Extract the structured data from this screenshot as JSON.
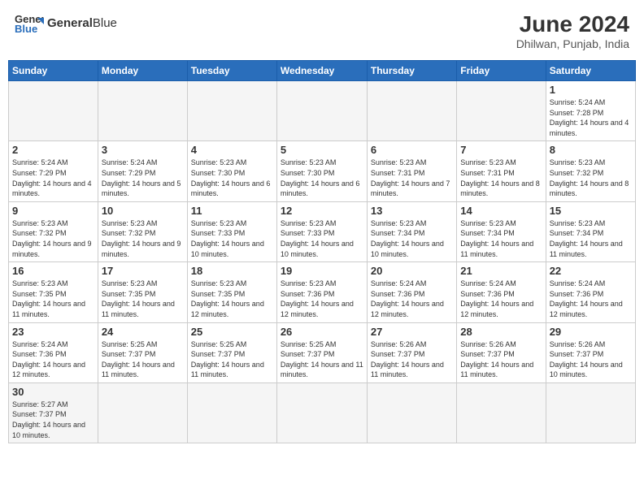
{
  "header": {
    "logo_general": "General",
    "logo_blue": "Blue",
    "month": "June 2024",
    "location": "Dhilwan, Punjab, India"
  },
  "days_of_week": [
    "Sunday",
    "Monday",
    "Tuesday",
    "Wednesday",
    "Thursday",
    "Friday",
    "Saturday"
  ],
  "weeks": [
    [
      {
        "day": "",
        "info": ""
      },
      {
        "day": "",
        "info": ""
      },
      {
        "day": "",
        "info": ""
      },
      {
        "day": "",
        "info": ""
      },
      {
        "day": "",
        "info": ""
      },
      {
        "day": "",
        "info": ""
      },
      {
        "day": "1",
        "info": "Sunrise: 5:24 AM\nSunset: 7:28 PM\nDaylight: 14 hours and 4 minutes."
      }
    ],
    [
      {
        "day": "2",
        "info": "Sunrise: 5:24 AM\nSunset: 7:29 PM\nDaylight: 14 hours and 4 minutes."
      },
      {
        "day": "3",
        "info": "Sunrise: 5:24 AM\nSunset: 7:29 PM\nDaylight: 14 hours and 5 minutes."
      },
      {
        "day": "4",
        "info": "Sunrise: 5:23 AM\nSunset: 7:30 PM\nDaylight: 14 hours and 6 minutes."
      },
      {
        "day": "5",
        "info": "Sunrise: 5:23 AM\nSunset: 7:30 PM\nDaylight: 14 hours and 6 minutes."
      },
      {
        "day": "6",
        "info": "Sunrise: 5:23 AM\nSunset: 7:31 PM\nDaylight: 14 hours and 7 minutes."
      },
      {
        "day": "7",
        "info": "Sunrise: 5:23 AM\nSunset: 7:31 PM\nDaylight: 14 hours and 8 minutes."
      },
      {
        "day": "8",
        "info": "Sunrise: 5:23 AM\nSunset: 7:32 PM\nDaylight: 14 hours and 8 minutes."
      }
    ],
    [
      {
        "day": "9",
        "info": "Sunrise: 5:23 AM\nSunset: 7:32 PM\nDaylight: 14 hours and 9 minutes."
      },
      {
        "day": "10",
        "info": "Sunrise: 5:23 AM\nSunset: 7:32 PM\nDaylight: 14 hours and 9 minutes."
      },
      {
        "day": "11",
        "info": "Sunrise: 5:23 AM\nSunset: 7:33 PM\nDaylight: 14 hours and 10 minutes."
      },
      {
        "day": "12",
        "info": "Sunrise: 5:23 AM\nSunset: 7:33 PM\nDaylight: 14 hours and 10 minutes."
      },
      {
        "day": "13",
        "info": "Sunrise: 5:23 AM\nSunset: 7:34 PM\nDaylight: 14 hours and 10 minutes."
      },
      {
        "day": "14",
        "info": "Sunrise: 5:23 AM\nSunset: 7:34 PM\nDaylight: 14 hours and 11 minutes."
      },
      {
        "day": "15",
        "info": "Sunrise: 5:23 AM\nSunset: 7:34 PM\nDaylight: 14 hours and 11 minutes."
      }
    ],
    [
      {
        "day": "16",
        "info": "Sunrise: 5:23 AM\nSunset: 7:35 PM\nDaylight: 14 hours and 11 minutes."
      },
      {
        "day": "17",
        "info": "Sunrise: 5:23 AM\nSunset: 7:35 PM\nDaylight: 14 hours and 11 minutes."
      },
      {
        "day": "18",
        "info": "Sunrise: 5:23 AM\nSunset: 7:35 PM\nDaylight: 14 hours and 12 minutes."
      },
      {
        "day": "19",
        "info": "Sunrise: 5:23 AM\nSunset: 7:36 PM\nDaylight: 14 hours and 12 minutes."
      },
      {
        "day": "20",
        "info": "Sunrise: 5:24 AM\nSunset: 7:36 PM\nDaylight: 14 hours and 12 minutes."
      },
      {
        "day": "21",
        "info": "Sunrise: 5:24 AM\nSunset: 7:36 PM\nDaylight: 14 hours and 12 minutes."
      },
      {
        "day": "22",
        "info": "Sunrise: 5:24 AM\nSunset: 7:36 PM\nDaylight: 14 hours and 12 minutes."
      }
    ],
    [
      {
        "day": "23",
        "info": "Sunrise: 5:24 AM\nSunset: 7:36 PM\nDaylight: 14 hours and 12 minutes."
      },
      {
        "day": "24",
        "info": "Sunrise: 5:25 AM\nSunset: 7:37 PM\nDaylight: 14 hours and 11 minutes."
      },
      {
        "day": "25",
        "info": "Sunrise: 5:25 AM\nSunset: 7:37 PM\nDaylight: 14 hours and 11 minutes."
      },
      {
        "day": "26",
        "info": "Sunrise: 5:25 AM\nSunset: 7:37 PM\nDaylight: 14 hours and 11 minutes."
      },
      {
        "day": "27",
        "info": "Sunrise: 5:26 AM\nSunset: 7:37 PM\nDaylight: 14 hours and 11 minutes."
      },
      {
        "day": "28",
        "info": "Sunrise: 5:26 AM\nSunset: 7:37 PM\nDaylight: 14 hours and 11 minutes."
      },
      {
        "day": "29",
        "info": "Sunrise: 5:26 AM\nSunset: 7:37 PM\nDaylight: 14 hours and 10 minutes."
      }
    ],
    [
      {
        "day": "30",
        "info": "Sunrise: 5:27 AM\nSunset: 7:37 PM\nDaylight: 14 hours and 10 minutes."
      },
      {
        "day": "",
        "info": ""
      },
      {
        "day": "",
        "info": ""
      },
      {
        "day": "",
        "info": ""
      },
      {
        "day": "",
        "info": ""
      },
      {
        "day": "",
        "info": ""
      },
      {
        "day": "",
        "info": ""
      }
    ]
  ]
}
